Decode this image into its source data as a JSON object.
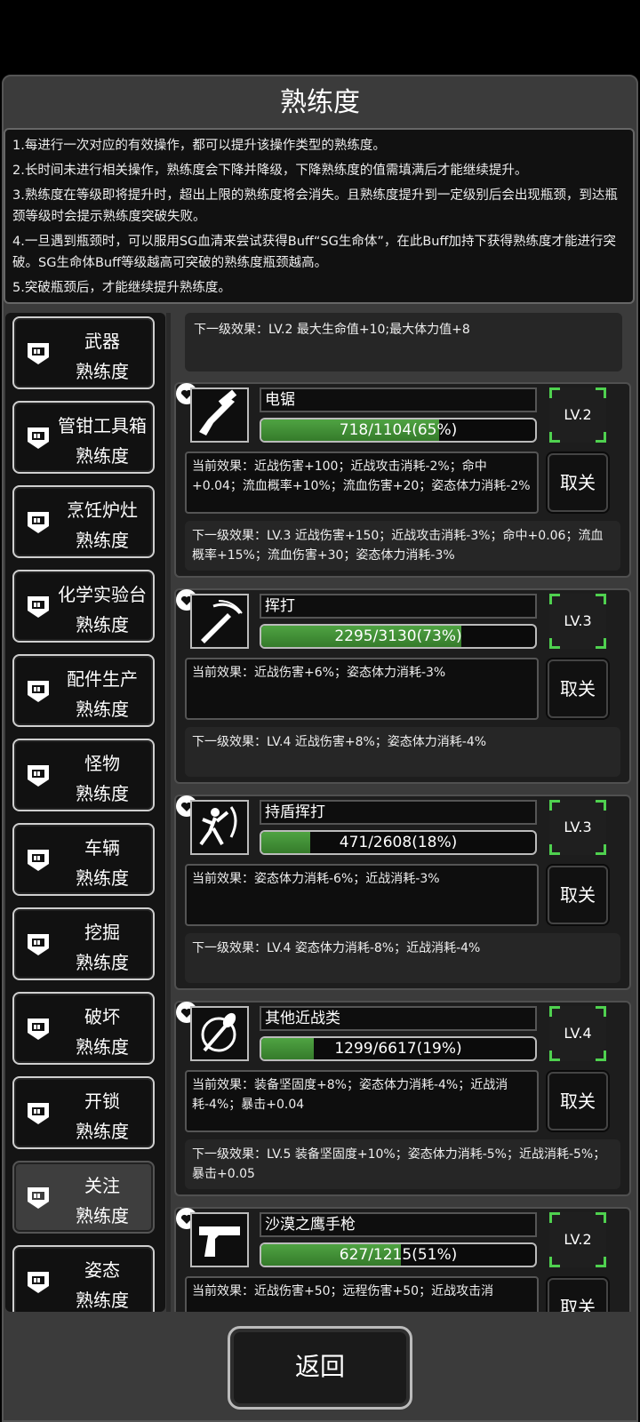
{
  "page_title": "熟练度",
  "notes": [
    "1.每进行一次对应的有效操作，都可以提升该操作类型的熟练度。",
    "2.长时间未进行相关操作，熟练度会下降并降级，下降熟练度的值需填满后才能继续提升。",
    "3.熟练度在等级即将提升时，超出上限的熟练度将会消失。且熟练度提升到一定级别后会出现瓶颈，到达瓶颈等级时会提示熟练度突破失败。",
    "4.一旦遇到瓶颈时，可以服用SG血清来尝试获得Buff“SG生命体”，在此Buff加持下获得熟练度才能进行突破。SG生命体Buff等级越高可突破的熟练度瓶颈越高。",
    "5.突破瓶颈后，才能继续提升熟练度。"
  ],
  "categories": [
    {
      "line1": "武器",
      "line2": "熟练度"
    },
    {
      "line1": "管钳工具箱",
      "line2": "熟练度"
    },
    {
      "line1": "烹饪炉灶",
      "line2": "熟练度"
    },
    {
      "line1": "化学实验台",
      "line2": "熟练度"
    },
    {
      "line1": "配件生产",
      "line2": "熟练度"
    },
    {
      "line1": "怪物",
      "line2": "熟练度"
    },
    {
      "line1": "车辆",
      "line2": "熟练度"
    },
    {
      "line1": "挖掘",
      "line2": "熟练度"
    },
    {
      "line1": "破坏",
      "line2": "熟练度"
    },
    {
      "line1": "开锁",
      "line2": "熟练度"
    },
    {
      "line1": "关注",
      "line2": "熟练度"
    },
    {
      "line1": "姿态",
      "line2": "熟练度"
    }
  ],
  "selected_category": "关注",
  "top_partial_next": "下一级效果：LV.2 最大生命值+10;最大体力值+8",
  "skills": [
    {
      "name": "电锯",
      "icon": "chainsaw-icon",
      "progress_text": "718/1104(65%)",
      "progress": 0.65,
      "level": "LV.2",
      "current": "当前效果：近战伤害+100；近战攻击消耗-2%；命中+0.04；流血概率+10%；流血伤害+20；姿态体力消耗-2%",
      "next": "下一级效果：LV.3 近战伤害+150；近战攻击消耗-3%；命中+0.06；流血概率+15%；流血伤害+30；姿态体力消耗-3%",
      "cancel": "取关"
    },
    {
      "name": "挥打",
      "icon": "bat-swing-icon",
      "progress_text": "2295/3130(73%)",
      "progress": 0.73,
      "level": "LV.3",
      "current": "当前效果：近战伤害+6%；姿态体力消耗-3%",
      "next": "下一级效果：LV.4 近战伤害+8%；姿态体力消耗-4%",
      "cancel": "取关"
    },
    {
      "name": "持盾挥打",
      "icon": "shield-swing-icon",
      "progress_text": "471/2608(18%)",
      "progress": 0.18,
      "level": "LV.3",
      "current": "当前效果：姿态体力消耗-6%；近战消耗-3%",
      "next": "下一级效果：LV.4 姿态体力消耗-8%；近战消耗-4%",
      "cancel": "取关"
    },
    {
      "name": "其他近战类",
      "icon": "other-melee-icon",
      "progress_text": "1299/6617(19%)",
      "progress": 0.19,
      "level": "LV.4",
      "current": "当前效果：装备坚固度+8%；姿态体力消耗-4%；近战消耗-4%；暴击+0.04",
      "next": "下一级效果：LV.5 装备坚固度+10%；姿态体力消耗-5%；近战消耗-5%；暴击+0.05",
      "cancel": "取关"
    },
    {
      "name": "沙漠之鹰手枪",
      "icon": "desert-eagle-icon",
      "progress_text": "627/1215(51%)",
      "progress": 0.51,
      "level": "LV.2",
      "current": "当前效果：近战伤害+50；远程伤害+50；近战攻击消",
      "next": "",
      "cancel": "取关"
    }
  ],
  "back_label": "返回",
  "colors": {
    "progress_green": "#3f8f35",
    "level_corner": "#4fd14f"
  }
}
